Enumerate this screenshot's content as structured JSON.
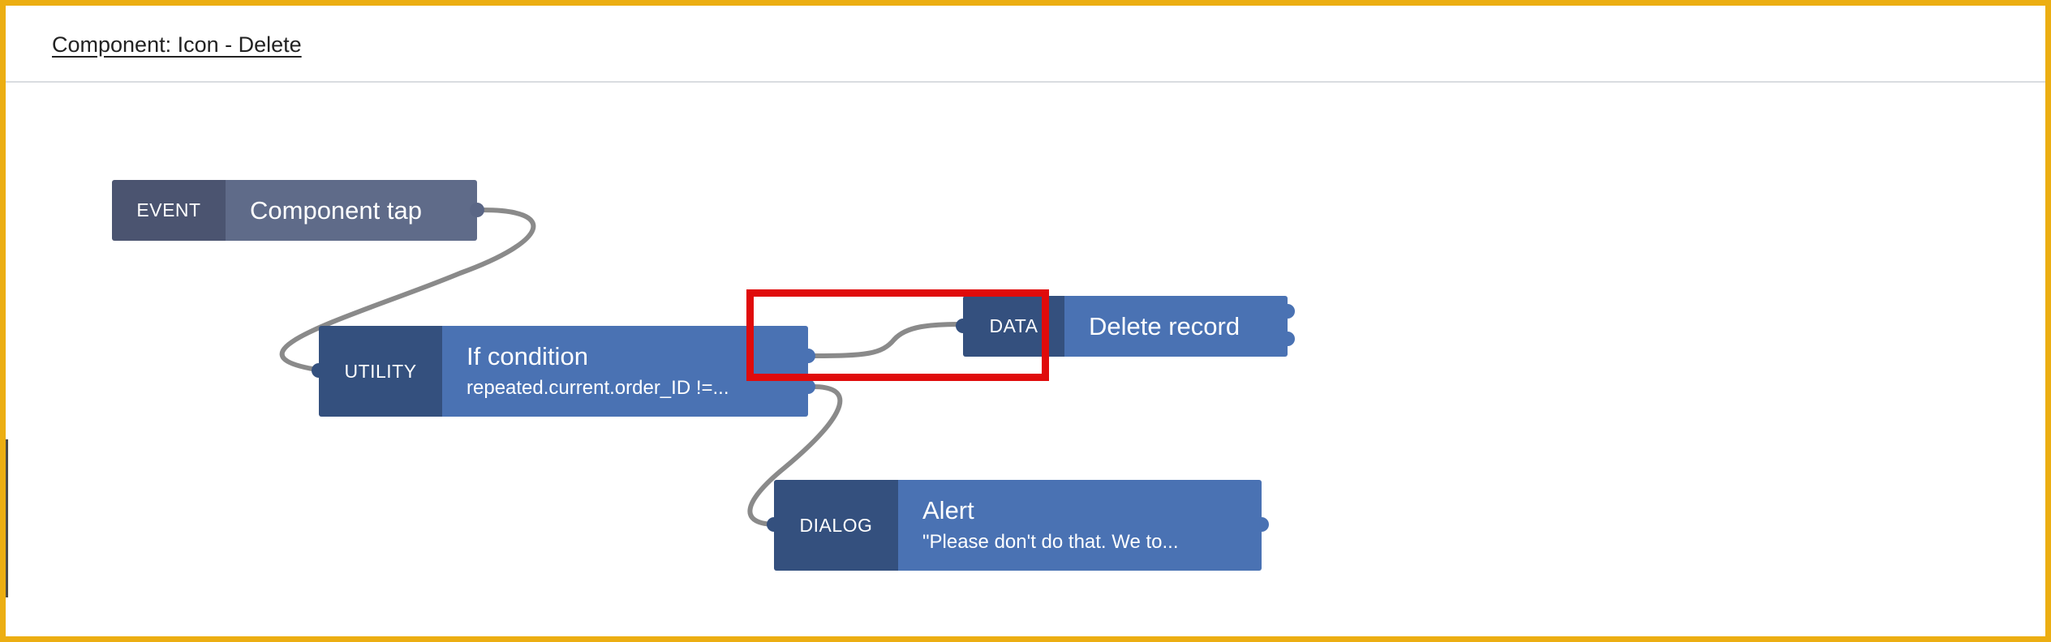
{
  "header": {
    "title": "Component: Icon - Delete"
  },
  "blocks": {
    "event": {
      "badge": "EVENT",
      "title": "Component tap"
    },
    "utility": {
      "badge": "UTILITY",
      "title": "If condition",
      "subtitle": "repeated.current.order_ID !=..."
    },
    "data": {
      "badge": "DATA",
      "title": "Delete record"
    },
    "dialog": {
      "badge": "DIALOG",
      "title": "Alert",
      "subtitle": "\"Please don't do that. We to..."
    }
  },
  "colors": {
    "frame": "#ecae12",
    "event_badge": "#4b5470",
    "event_body": "#5f6b89",
    "action_badge": "#34507e",
    "action_body": "#4a72b3",
    "wire": "#8a8a8a",
    "highlight": "#e00b0b"
  }
}
